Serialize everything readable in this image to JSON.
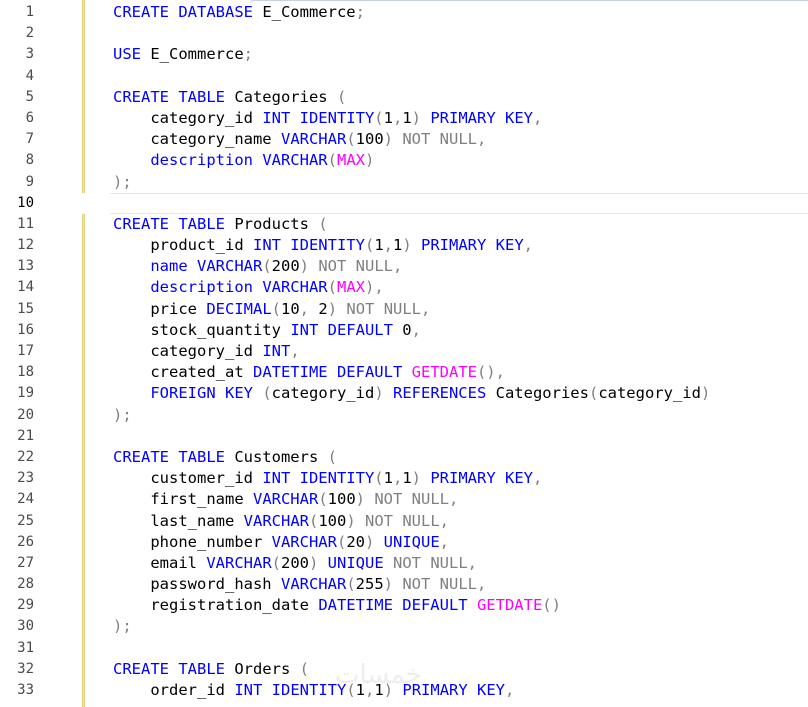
{
  "editor": {
    "current_line": 10,
    "lines": [
      {
        "n": "1",
        "tokens": [
          {
            "t": "CREATE DATABASE",
            "c": "kw"
          },
          {
            "t": " E_Commerce",
            "c": "id"
          },
          {
            "t": ";",
            "c": "gray"
          }
        ]
      },
      {
        "n": "2",
        "tokens": []
      },
      {
        "n": "3",
        "tokens": [
          {
            "t": "USE",
            "c": "kw"
          },
          {
            "t": " E_Commerce",
            "c": "id"
          },
          {
            "t": ";",
            "c": "gray"
          }
        ]
      },
      {
        "n": "4",
        "tokens": []
      },
      {
        "n": "5",
        "tokens": [
          {
            "t": "CREATE TABLE",
            "c": "kw"
          },
          {
            "t": " Categories ",
            "c": "id"
          },
          {
            "t": "(",
            "c": "gray"
          }
        ]
      },
      {
        "n": "6",
        "tokens": [
          {
            "t": "    category_id ",
            "c": "id"
          },
          {
            "t": "INT IDENTITY",
            "c": "kw"
          },
          {
            "t": "(",
            "c": "gray"
          },
          {
            "t": "1",
            "c": "id"
          },
          {
            "t": ",",
            "c": "gray"
          },
          {
            "t": "1",
            "c": "id"
          },
          {
            "t": ")",
            "c": "gray"
          },
          {
            "t": " PRIMARY KEY",
            "c": "kw"
          },
          {
            "t": ",",
            "c": "gray"
          }
        ]
      },
      {
        "n": "7",
        "tokens": [
          {
            "t": "    category_name ",
            "c": "id"
          },
          {
            "t": "VARCHAR",
            "c": "kw"
          },
          {
            "t": "(",
            "c": "gray"
          },
          {
            "t": "100",
            "c": "id"
          },
          {
            "t": ")",
            "c": "gray"
          },
          {
            "t": " NOT NULL,",
            "c": "gray"
          }
        ]
      },
      {
        "n": "8",
        "tokens": [
          {
            "t": "    description ",
            "c": "kw"
          },
          {
            "t": "VARCHAR",
            "c": "kw"
          },
          {
            "t": "(",
            "c": "gray"
          },
          {
            "t": "MAX",
            "c": "fn"
          },
          {
            "t": ")",
            "c": "gray"
          }
        ]
      },
      {
        "n": "9",
        "tokens": [
          {
            "t": ");",
            "c": "gray"
          }
        ]
      },
      {
        "n": "10",
        "tokens": []
      },
      {
        "n": "11",
        "tokens": [
          {
            "t": "CREATE TABLE",
            "c": "kw"
          },
          {
            "t": " Products ",
            "c": "id"
          },
          {
            "t": "(",
            "c": "gray"
          }
        ]
      },
      {
        "n": "12",
        "tokens": [
          {
            "t": "    product_id ",
            "c": "id"
          },
          {
            "t": "INT IDENTITY",
            "c": "kw"
          },
          {
            "t": "(",
            "c": "gray"
          },
          {
            "t": "1",
            "c": "id"
          },
          {
            "t": ",",
            "c": "gray"
          },
          {
            "t": "1",
            "c": "id"
          },
          {
            "t": ")",
            "c": "gray"
          },
          {
            "t": " PRIMARY KEY",
            "c": "kw"
          },
          {
            "t": ",",
            "c": "gray"
          }
        ]
      },
      {
        "n": "13",
        "tokens": [
          {
            "t": "    name ",
            "c": "kw"
          },
          {
            "t": "VARCHAR",
            "c": "kw"
          },
          {
            "t": "(",
            "c": "gray"
          },
          {
            "t": "200",
            "c": "id"
          },
          {
            "t": ")",
            "c": "gray"
          },
          {
            "t": " NOT NULL,",
            "c": "gray"
          }
        ]
      },
      {
        "n": "14",
        "tokens": [
          {
            "t": "    description ",
            "c": "kw"
          },
          {
            "t": "VARCHAR",
            "c": "kw"
          },
          {
            "t": "(",
            "c": "gray"
          },
          {
            "t": "MAX",
            "c": "fn"
          },
          {
            "t": "),",
            "c": "gray"
          }
        ]
      },
      {
        "n": "15",
        "tokens": [
          {
            "t": "    price ",
            "c": "id"
          },
          {
            "t": "DECIMAL",
            "c": "kw"
          },
          {
            "t": "(",
            "c": "gray"
          },
          {
            "t": "10",
            "c": "id"
          },
          {
            "t": ", ",
            "c": "gray"
          },
          {
            "t": "2",
            "c": "id"
          },
          {
            "t": ")",
            "c": "gray"
          },
          {
            "t": " NOT NULL,",
            "c": "gray"
          }
        ]
      },
      {
        "n": "16",
        "tokens": [
          {
            "t": "    stock_quantity ",
            "c": "id"
          },
          {
            "t": "INT DEFAULT",
            "c": "kw"
          },
          {
            "t": " 0",
            "c": "id"
          },
          {
            "t": ",",
            "c": "gray"
          }
        ]
      },
      {
        "n": "17",
        "tokens": [
          {
            "t": "    category_id ",
            "c": "id"
          },
          {
            "t": "INT",
            "c": "kw"
          },
          {
            "t": ",",
            "c": "gray"
          }
        ]
      },
      {
        "n": "18",
        "tokens": [
          {
            "t": "    created_at ",
            "c": "id"
          },
          {
            "t": "DATETIME DEFAULT",
            "c": "kw"
          },
          {
            "t": " GETDATE",
            "c": "fn"
          },
          {
            "t": "(),",
            "c": "gray"
          }
        ]
      },
      {
        "n": "19",
        "tokens": [
          {
            "t": "    FOREIGN KEY",
            "c": "kw"
          },
          {
            "t": " (",
            "c": "gray"
          },
          {
            "t": "category_id",
            "c": "id"
          },
          {
            "t": ")",
            "c": "gray"
          },
          {
            "t": " REFERENCES",
            "c": "kw"
          },
          {
            "t": " Categories",
            "c": "id"
          },
          {
            "t": "(",
            "c": "gray"
          },
          {
            "t": "category_id",
            "c": "id"
          },
          {
            "t": ")",
            "c": "gray"
          }
        ]
      },
      {
        "n": "20",
        "tokens": [
          {
            "t": ");",
            "c": "gray"
          }
        ]
      },
      {
        "n": "21",
        "tokens": []
      },
      {
        "n": "22",
        "tokens": [
          {
            "t": "CREATE TABLE",
            "c": "kw"
          },
          {
            "t": " Customers ",
            "c": "id"
          },
          {
            "t": "(",
            "c": "gray"
          }
        ]
      },
      {
        "n": "23",
        "tokens": [
          {
            "t": "    customer_id ",
            "c": "id"
          },
          {
            "t": "INT IDENTITY",
            "c": "kw"
          },
          {
            "t": "(",
            "c": "gray"
          },
          {
            "t": "1",
            "c": "id"
          },
          {
            "t": ",",
            "c": "gray"
          },
          {
            "t": "1",
            "c": "id"
          },
          {
            "t": ")",
            "c": "gray"
          },
          {
            "t": " PRIMARY KEY",
            "c": "kw"
          },
          {
            "t": ",",
            "c": "gray"
          }
        ]
      },
      {
        "n": "24",
        "tokens": [
          {
            "t": "    first_name ",
            "c": "id"
          },
          {
            "t": "VARCHAR",
            "c": "kw"
          },
          {
            "t": "(",
            "c": "gray"
          },
          {
            "t": "100",
            "c": "id"
          },
          {
            "t": ")",
            "c": "gray"
          },
          {
            "t": " NOT NULL,",
            "c": "gray"
          }
        ]
      },
      {
        "n": "25",
        "tokens": [
          {
            "t": "    last_name ",
            "c": "id"
          },
          {
            "t": "VARCHAR",
            "c": "kw"
          },
          {
            "t": "(",
            "c": "gray"
          },
          {
            "t": "100",
            "c": "id"
          },
          {
            "t": ")",
            "c": "gray"
          },
          {
            "t": " NOT NULL,",
            "c": "gray"
          }
        ]
      },
      {
        "n": "26",
        "tokens": [
          {
            "t": "    phone_number ",
            "c": "id"
          },
          {
            "t": "VARCHAR",
            "c": "kw"
          },
          {
            "t": "(",
            "c": "gray"
          },
          {
            "t": "20",
            "c": "id"
          },
          {
            "t": ")",
            "c": "gray"
          },
          {
            "t": " UNIQUE",
            "c": "kw"
          },
          {
            "t": ",",
            "c": "gray"
          }
        ]
      },
      {
        "n": "27",
        "tokens": [
          {
            "t": "    email ",
            "c": "id"
          },
          {
            "t": "VARCHAR",
            "c": "kw"
          },
          {
            "t": "(",
            "c": "gray"
          },
          {
            "t": "200",
            "c": "id"
          },
          {
            "t": ")",
            "c": "gray"
          },
          {
            "t": " UNIQUE",
            "c": "kw"
          },
          {
            "t": " NOT NULL,",
            "c": "gray"
          }
        ]
      },
      {
        "n": "28",
        "tokens": [
          {
            "t": "    password_hash ",
            "c": "id"
          },
          {
            "t": "VARCHAR",
            "c": "kw"
          },
          {
            "t": "(",
            "c": "gray"
          },
          {
            "t": "255",
            "c": "id"
          },
          {
            "t": ")",
            "c": "gray"
          },
          {
            "t": " NOT NULL,",
            "c": "gray"
          }
        ]
      },
      {
        "n": "29",
        "tokens": [
          {
            "t": "    registration_date ",
            "c": "id"
          },
          {
            "t": "DATETIME DEFAULT",
            "c": "kw"
          },
          {
            "t": " GETDATE",
            "c": "fn"
          },
          {
            "t": "()",
            "c": "gray"
          }
        ]
      },
      {
        "n": "30",
        "tokens": [
          {
            "t": ");",
            "c": "gray"
          }
        ]
      },
      {
        "n": "31",
        "tokens": []
      },
      {
        "n": "32",
        "tokens": [
          {
            "t": "CREATE TABLE",
            "c": "kw"
          },
          {
            "t": " Orders ",
            "c": "id"
          },
          {
            "t": "(",
            "c": "gray"
          }
        ]
      },
      {
        "n": "33",
        "tokens": [
          {
            "t": "    order_id ",
            "c": "id"
          },
          {
            "t": "INT IDENTITY",
            "c": "kw"
          },
          {
            "t": "(",
            "c": "gray"
          },
          {
            "t": "1",
            "c": "id"
          },
          {
            "t": ",",
            "c": "gray"
          },
          {
            "t": "1",
            "c": "id"
          },
          {
            "t": ")",
            "c": "gray"
          },
          {
            "t": " PRIMARY KEY",
            "c": "kw"
          },
          {
            "t": ",",
            "c": "gray"
          }
        ]
      }
    ]
  },
  "watermark": {
    "text": "خمسات"
  }
}
